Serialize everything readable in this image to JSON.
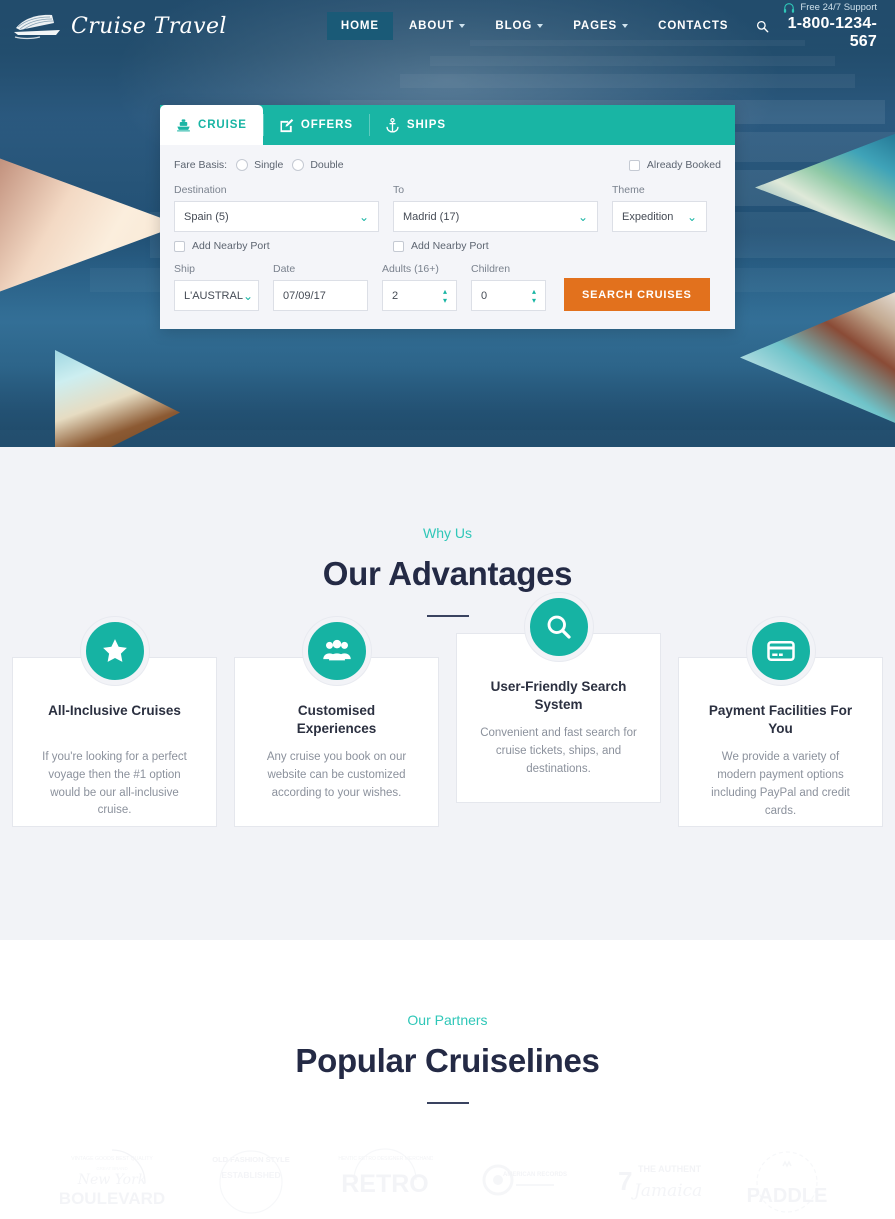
{
  "header": {
    "logo_text": "Cruise Travel",
    "logo_icon": "cruise-ship-icon",
    "menu": [
      {
        "label": "HOME",
        "active": true,
        "caret": false
      },
      {
        "label": "ABOUT",
        "active": false,
        "caret": true
      },
      {
        "label": "BLOG",
        "active": false,
        "caret": true
      },
      {
        "label": "PAGES",
        "active": false,
        "caret": true
      },
      {
        "label": "CONTACTS",
        "active": false,
        "caret": false
      }
    ],
    "search_icon": "search-icon",
    "support_icon": "headset-icon",
    "support_label": "Free 24/7 Support",
    "phone": "1-800-1234-567"
  },
  "booking": {
    "tabs": [
      {
        "label": "CRUISE",
        "icon": "ship-icon",
        "active": true
      },
      {
        "label": "OFFERS",
        "icon": "edit-note-icon",
        "active": false
      },
      {
        "label": "SHIPS",
        "icon": "anchor-icon",
        "active": false
      }
    ],
    "fare_basis_label": "Fare Basis:",
    "fare_options": [
      {
        "label": "Single",
        "checked": false
      },
      {
        "label": "Double",
        "checked": false
      }
    ],
    "already_booked": {
      "label": "Already Booked",
      "checked": false
    },
    "destination": {
      "label": "Destination",
      "value": "Spain (5)"
    },
    "to": {
      "label": "To",
      "value": "Madrid (17)"
    },
    "theme": {
      "label": "Theme",
      "value": "Expedition"
    },
    "nearby_port_1": {
      "label": "Add Nearby Port",
      "checked": false
    },
    "nearby_port_2": {
      "label": "Add Nearby Port",
      "checked": false
    },
    "ship": {
      "label": "Ship",
      "value": "L'AUSTRAL"
    },
    "date": {
      "label": "Date",
      "value": "07/09/17"
    },
    "adults": {
      "label": "Adults (16+)",
      "value": "2"
    },
    "children": {
      "label": "Children",
      "value": "0"
    },
    "submit_label": "SEARCH CRUISES"
  },
  "advantages": {
    "kicker": "Why Us",
    "title": "Our Advantages",
    "cards": [
      {
        "icon": "star-icon",
        "title": "All-Inclusive Cruises",
        "text": "If you're looking for a perfect voyage then the #1 option would be our all-inclusive cruise."
      },
      {
        "icon": "users-group-icon",
        "title": "Customised Experiences",
        "text": "Any cruise you book on our website can be customized according to your wishes."
      },
      {
        "icon": "search-icon",
        "title": "User-Friendly Search System",
        "text": "Convenient and fast search for cruise tickets, ships, and destinations."
      },
      {
        "icon": "credit-card-icon",
        "title": "Payment Facilities For You",
        "text": "We provide a variety of modern payment options including PayPal and credit cards."
      }
    ]
  },
  "partners": {
    "kicker": "Our Partners",
    "title": "Popular Cruiselines",
    "logos": [
      {
        "name": "new-york-boulevard-badge",
        "line1": "VINTAGE GOODS BEST QUALITY",
        "line2": "New York",
        "line3": "BOULEVARD"
      },
      {
        "name": "old-fashion-style-badge",
        "line1": "OLD FASHION STYLE",
        "line2": "ESTABLISHED"
      },
      {
        "name": "retro-designer-badge",
        "line1": "AUTHENTIC RETRO DESIGNER MERCHANDISE",
        "line2": "RETRO"
      },
      {
        "name": "american-records-badge",
        "line1": "AMERICAN RECORDS",
        "line2": ""
      },
      {
        "name": "authentic-jamaica-badge",
        "line1": "THE AUTHENTIC",
        "line2": "Jamaican"
      },
      {
        "name": "paddle-crown-badge",
        "line1": "PADDLE",
        "line2": ""
      }
    ]
  },
  "colors": {
    "accent_teal": "#19b5a4",
    "accent_orange": "#e2711d",
    "nav_active": "#1a5a77",
    "heading_navy": "#242a45",
    "section_bg": "#f2f3f7"
  }
}
